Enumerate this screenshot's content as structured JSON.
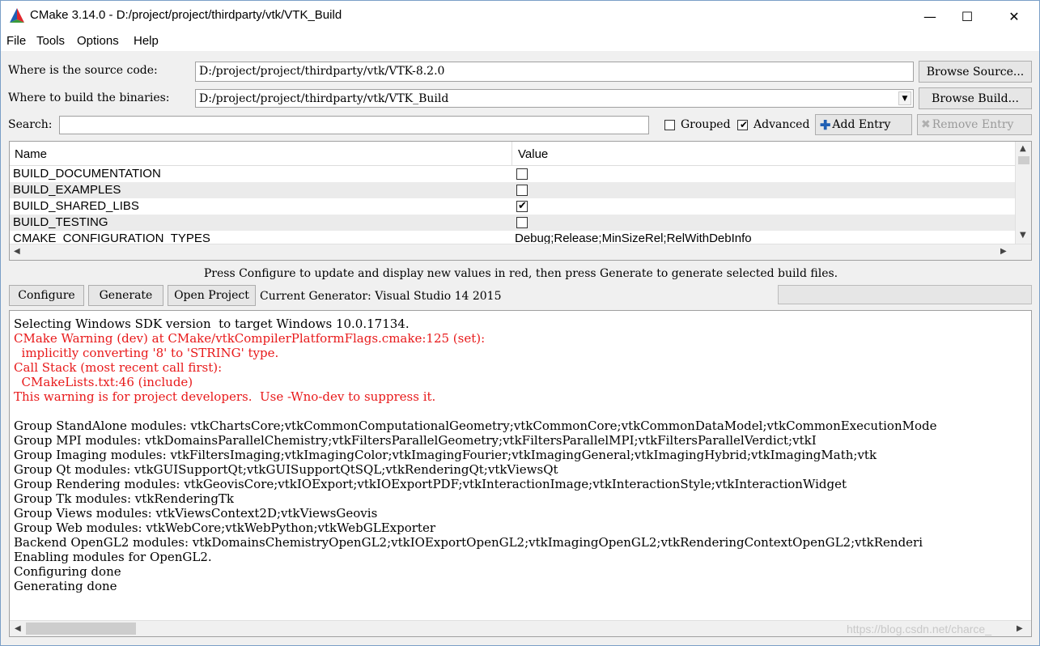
{
  "window": {
    "title": "CMake 3.14.0 - D:/project/project/thirdparty/vtk/VTK_Build",
    "minimize": "—",
    "maximize": "☐",
    "close": "✕"
  },
  "menu": [
    "File",
    "Tools",
    "Options",
    "Help"
  ],
  "source": {
    "label": "Where is the source code:",
    "value": "D:/project/project/thirdparty/vtk/VTK-8.2.0",
    "button": "Browse Source..."
  },
  "build": {
    "label": "Where to build the binaries:",
    "value": "D:/project/project/thirdparty/vtk/VTK_Build",
    "button": "Browse Build..."
  },
  "search": {
    "label": "Search:",
    "value": "",
    "grouped_label": "Grouped",
    "grouped_checked": false,
    "advanced_label": "Advanced",
    "advanced_checked": true,
    "add_entry": "Add Entry",
    "remove_entry": "Remove Entry"
  },
  "table": {
    "headers": [
      "Name",
      "Value"
    ],
    "rows": [
      {
        "name": "BUILD_DOCUMENTATION",
        "type": "bool",
        "checked": false
      },
      {
        "name": "BUILD_EXAMPLES",
        "type": "bool",
        "checked": false
      },
      {
        "name": "BUILD_SHARED_LIBS",
        "type": "bool",
        "checked": true
      },
      {
        "name": "BUILD_TESTING",
        "type": "bool",
        "checked": false
      },
      {
        "name": "CMAKE_CONFIGURATION_TYPES",
        "type": "string",
        "value": "Debug;Release;MinSizeRel;RelWithDebInfo"
      }
    ]
  },
  "hint": "Press Configure to update and display new values in red, then press Generate to generate selected build files.",
  "actions": {
    "configure": "Configure",
    "generate": "Generate",
    "open_project": "Open Project",
    "generator": "Current Generator: Visual Studio 14 2015"
  },
  "log": [
    {
      "text": "Selecting Windows SDK version  to target Windows 10.0.17134.",
      "color": "black"
    },
    {
      "text": "CMake Warning (dev) at CMake/vtkCompilerPlatformFlags.cmake:125 (set):",
      "color": "red"
    },
    {
      "text": "  implicitly converting '8' to 'STRING' type.",
      "color": "red"
    },
    {
      "text": "Call Stack (most recent call first):",
      "color": "red"
    },
    {
      "text": "  CMakeLists.txt:46 (include)",
      "color": "red"
    },
    {
      "text": "This warning is for project developers.  Use -Wno-dev to suppress it.",
      "color": "red"
    },
    {
      "text": "",
      "color": "black"
    },
    {
      "text": "Group StandAlone modules: vtkChartsCore;vtkCommonComputationalGeometry;vtkCommonCore;vtkCommonDataModel;vtkCommonExecutionMode",
      "color": "black"
    },
    {
      "text": "Group MPI modules: vtkDomainsParallelChemistry;vtkFiltersParallelGeometry;vtkFiltersParallelMPI;vtkFiltersParallelVerdict;vtkI",
      "color": "black"
    },
    {
      "text": "Group Imaging modules: vtkFiltersImaging;vtkImagingColor;vtkImagingFourier;vtkImagingGeneral;vtkImagingHybrid;vtkImagingMath;vtk",
      "color": "black"
    },
    {
      "text": "Group Qt modules: vtkGUISupportQt;vtkGUISupportQtSQL;vtkRenderingQt;vtkViewsQt",
      "color": "black"
    },
    {
      "text": "Group Rendering modules: vtkGeovisCore;vtkIOExport;vtkIOExportPDF;vtkInteractionImage;vtkInteractionStyle;vtkInteractionWidget",
      "color": "black"
    },
    {
      "text": "Group Tk modules: vtkRenderingTk",
      "color": "black"
    },
    {
      "text": "Group Views modules: vtkViewsContext2D;vtkViewsGeovis",
      "color": "black"
    },
    {
      "text": "Group Web modules: vtkWebCore;vtkWebPython;vtkWebGLExporter",
      "color": "black"
    },
    {
      "text": "Backend OpenGL2 modules: vtkDomainsChemistryOpenGL2;vtkIOExportOpenGL2;vtkImagingOpenGL2;vtkRenderingContextOpenGL2;vtkRenderi",
      "color": "black"
    },
    {
      "text": "Enabling modules for OpenGL2.",
      "color": "black"
    },
    {
      "text": "Configuring done",
      "color": "black"
    },
    {
      "text": "Generating done",
      "color": "black"
    }
  ],
  "watermark": "https://blog.csdn.net/charce_",
  "colors": {
    "warning": "#e8191a",
    "titlebar": "#ffffff",
    "window_bg": "#f0f0f0"
  }
}
